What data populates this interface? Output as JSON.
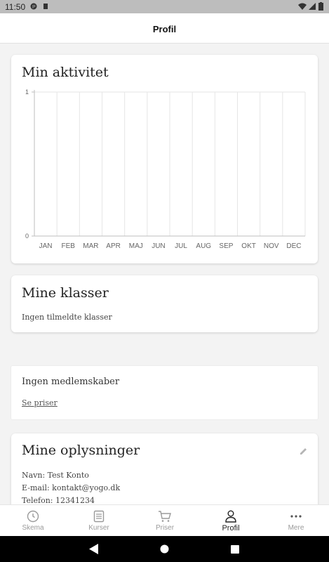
{
  "status_bar": {
    "time": "11:50"
  },
  "header": {
    "title": "Profil"
  },
  "activity": {
    "title": "Min aktivitet"
  },
  "chart_data": {
    "type": "line",
    "categories": [
      "JAN",
      "FEB",
      "MAR",
      "APR",
      "MAJ",
      "JUN",
      "JUL",
      "AUG",
      "SEP",
      "OKT",
      "NOV",
      "DEC"
    ],
    "series": [],
    "ylim": [
      0,
      1
    ],
    "yticks": [
      "0",
      "1"
    ],
    "grid": true
  },
  "classes": {
    "title": "Mine klasser",
    "empty_text": "Ingen tilmeldte klasser"
  },
  "memberships": {
    "empty_text": "Ingen medlemskaber",
    "link_text": "Se priser"
  },
  "info": {
    "title": "Mine oplysninger",
    "name_line": "Navn: Test Konto",
    "email_line": "E-mail: kontakt@yogo.dk",
    "phone_line": "Telefon: 12341234"
  },
  "nav": {
    "items": [
      {
        "label": "Skema",
        "icon": "clock-icon"
      },
      {
        "label": "Kurser",
        "icon": "list-icon"
      },
      {
        "label": "Priser",
        "icon": "cart-icon"
      },
      {
        "label": "Profil",
        "icon": "person-icon"
      },
      {
        "label": "Mere",
        "icon": "more-dots-icon"
      }
    ],
    "active_index": 3
  }
}
